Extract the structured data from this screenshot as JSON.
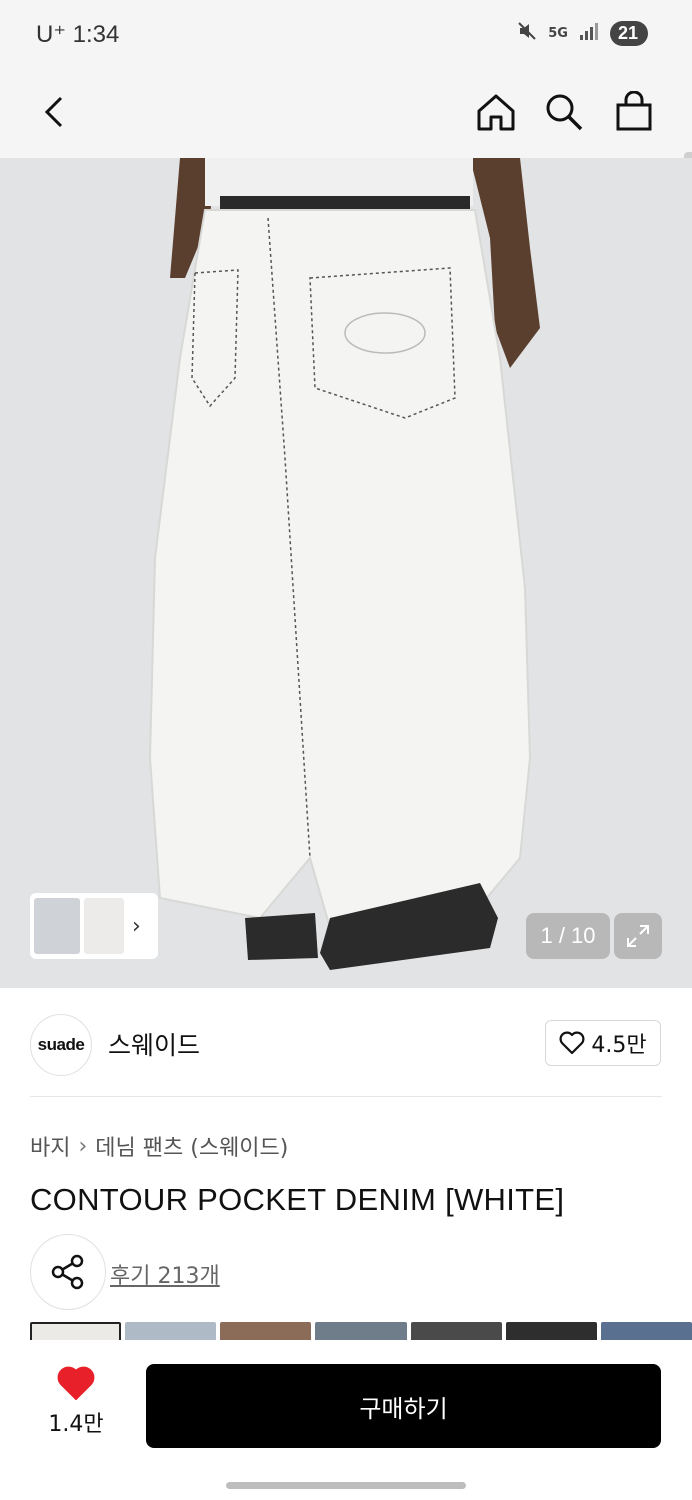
{
  "status_bar": {
    "carrier": "U⁺ 1:34",
    "network": "5G",
    "battery": "21"
  },
  "header": {
    "back_icon": "chevron-left-icon",
    "home_icon": "home-icon",
    "search_icon": "search-icon",
    "cart_icon": "shopping-bag-icon"
  },
  "gallery": {
    "page_indicator": "1 / 10",
    "expand_icon": "expand-icon"
  },
  "brand": {
    "logo_text": "suade",
    "name": "스웨이드",
    "like_count": "4.5만"
  },
  "product": {
    "breadcrumb": [
      "바지",
      "데님 팬츠 (스웨이드)"
    ],
    "title": "CONTOUR POCKET DENIM [WHITE]",
    "review_link": "후기 213개"
  },
  "bottom_bar": {
    "wishlist_count": "1.4만",
    "buy_label": "구매하기"
  },
  "colors": {
    "accent": "#000000",
    "heart": "#e8202a"
  }
}
